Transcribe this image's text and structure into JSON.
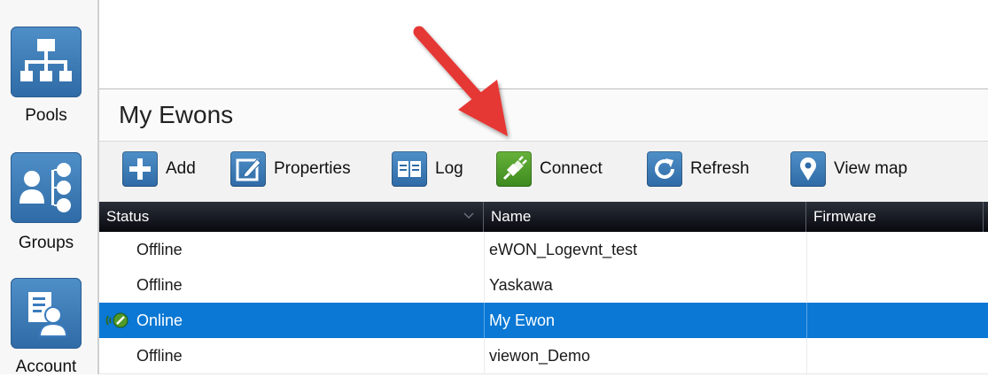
{
  "sidebar": {
    "items": [
      {
        "label": "Pools",
        "icon": "network-tree-icon"
      },
      {
        "label": "Groups",
        "icon": "group-icon"
      },
      {
        "label": "Account",
        "icon": "account-icon"
      }
    ]
  },
  "header": {
    "title": "My Ewons"
  },
  "toolbar": {
    "add": "Add",
    "properties": "Properties",
    "log": "Log",
    "connect": "Connect",
    "refresh": "Refresh",
    "view_map": "View map"
  },
  "table": {
    "columns": [
      "Status",
      "Name",
      "Firmware"
    ],
    "rows": [
      {
        "status": "Offline",
        "name": "eWON_Logevnt_test",
        "firmware": "",
        "selected": false
      },
      {
        "status": "Offline",
        "name": "Yaskawa",
        "firmware": "",
        "selected": false
      },
      {
        "status": "Online",
        "name": "My Ewon",
        "firmware": "",
        "selected": true
      },
      {
        "status": "Offline",
        "name": "viewon_Demo",
        "firmware": "",
        "selected": false
      }
    ]
  },
  "colors": {
    "accent": "#0a78d4",
    "sidebar_tile": "#3a7bbd",
    "connect_green": "#4f9a2a",
    "annotation_arrow": "#e53935"
  }
}
